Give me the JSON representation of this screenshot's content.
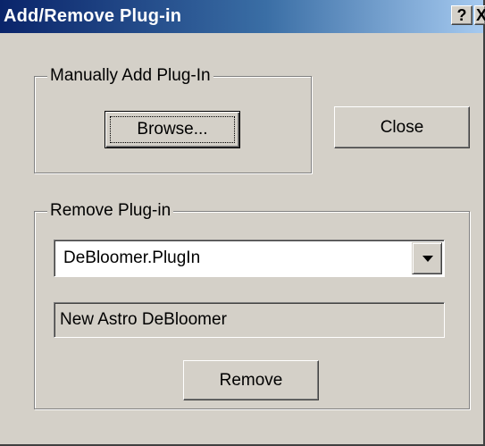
{
  "window": {
    "title": "Add/Remove Plug-in",
    "help_label": "?",
    "close_label": "X"
  },
  "add_group": {
    "label": "Manually Add Plug-In",
    "browse_label": "Browse..."
  },
  "close_button_label": "Close",
  "remove_group": {
    "label": "Remove Plug-in",
    "plugin_select": {
      "selected": "DeBloomer.PlugIn"
    },
    "description": "New Astro DeBloomer",
    "remove_label": "Remove"
  },
  "colors": {
    "titlebar_start": "#0a246a",
    "titlebar_end": "#a6caf0",
    "face": "#d4d0c8"
  }
}
